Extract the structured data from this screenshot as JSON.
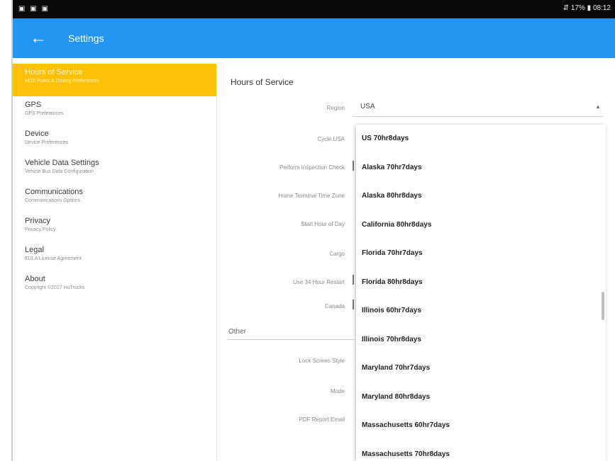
{
  "status_bar": {
    "left_icons": "▣ ▣ ▣",
    "right_text": "⇵ 17% ▮ 08:12"
  },
  "app_bar": {
    "back_icon": "arrow-left-icon",
    "title": "Settings"
  },
  "sidebar": {
    "items": [
      {
        "title": "Hours of Service",
        "subtitle": "HOS Rules & Driving Preferences"
      },
      {
        "title": "GPS",
        "subtitle": "GPS Preferences"
      },
      {
        "title": "Device",
        "subtitle": "Device Preferences"
      },
      {
        "title": "Vehicle Data Settings",
        "subtitle": "Vehicle Bus Data Configuration"
      },
      {
        "title": "Communications",
        "subtitle": "Communications Options"
      },
      {
        "title": "Privacy",
        "subtitle": "Privacy Policy"
      },
      {
        "title": "Legal",
        "subtitle": "EULA License Agreement"
      },
      {
        "title": "About",
        "subtitle": "Copyright ©2017 HuTrucks"
      }
    ]
  },
  "main": {
    "section_title": "Hours of Service",
    "region_label": "Region",
    "region_value": "USA",
    "region_arrow": "▲",
    "labels": {
      "cycle": "Cycle USA",
      "inspection": "Perform Inspection Check",
      "timezone": "Home Terminal Time Zone",
      "start_hour": "Start Hour of Day",
      "cargo": "Cargo",
      "restart": "Use 34 Hour Restart",
      "canada": "Canada",
      "lock_style": "Lock Screen Style",
      "mode": "Mode",
      "pdf_email": "PDF Report Email"
    },
    "other_title": "Other"
  },
  "dropdown": {
    "options": [
      "US 70hr8days",
      "Alaska 70hr7days",
      "Alaska 80hr8days",
      "California 80hr8days",
      "Florida 70hr7days",
      "Florida 80hr8days",
      "Illinois 60hr7days",
      "Illinois 70hr8days",
      "Maryland 70hr7days",
      "Maryland 80hr8days",
      "Massachusetts 60hr7days",
      "Massachusetts 70hr8days"
    ]
  },
  "colors": {
    "app_bar": "#2196f3",
    "active_nav": "#ffc107",
    "status_bar": "#0a0a0a"
  }
}
